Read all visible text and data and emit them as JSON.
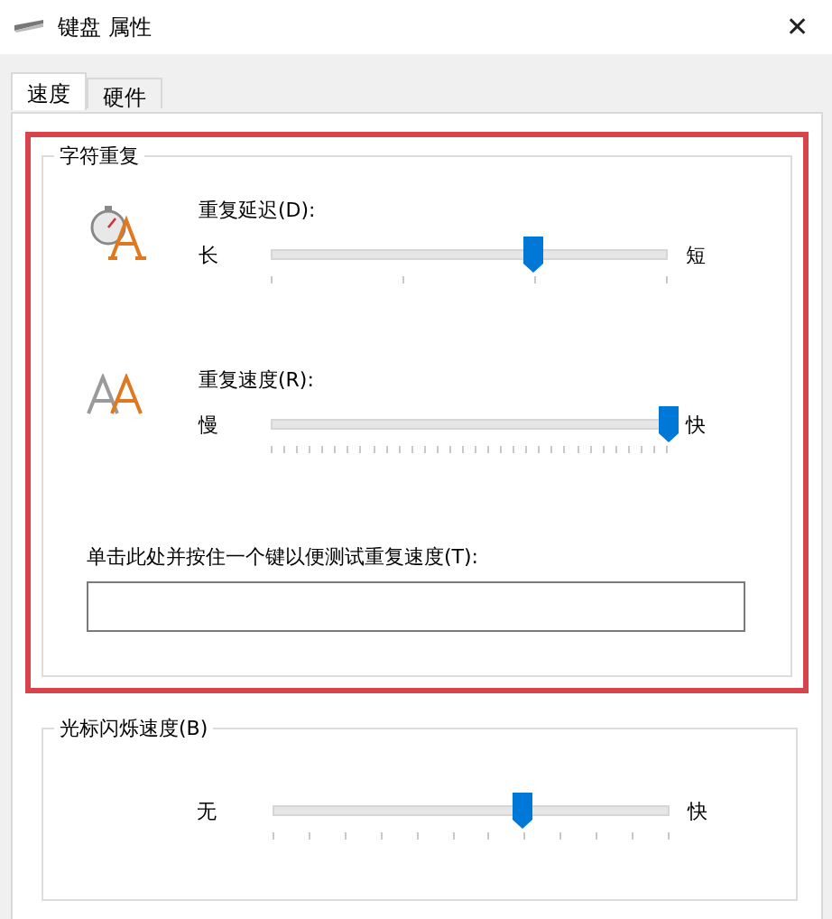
{
  "window": {
    "title": "键盘 属性",
    "close": "✕"
  },
  "tabs": [
    {
      "label": "速度",
      "selected": true
    },
    {
      "label": "硬件",
      "selected": false
    }
  ],
  "character_repeat": {
    "title": "字符重复",
    "sliders": [
      {
        "kind": "delay",
        "label": "重复延迟(D):",
        "min_label": "长",
        "max_label": "短",
        "level": 0.66
      },
      {
        "kind": "rate",
        "label": "重复速度(R):",
        "min_label": "慢",
        "max_label": "快",
        "level": 1.0
      }
    ],
    "test_label": "单击此处并按住一个键以便测试重复速度(T):"
  },
  "cursor_blink": {
    "title": "光标闪烁速度(B)",
    "min_label": "无",
    "max_label": "快",
    "level": 0.63
  }
}
